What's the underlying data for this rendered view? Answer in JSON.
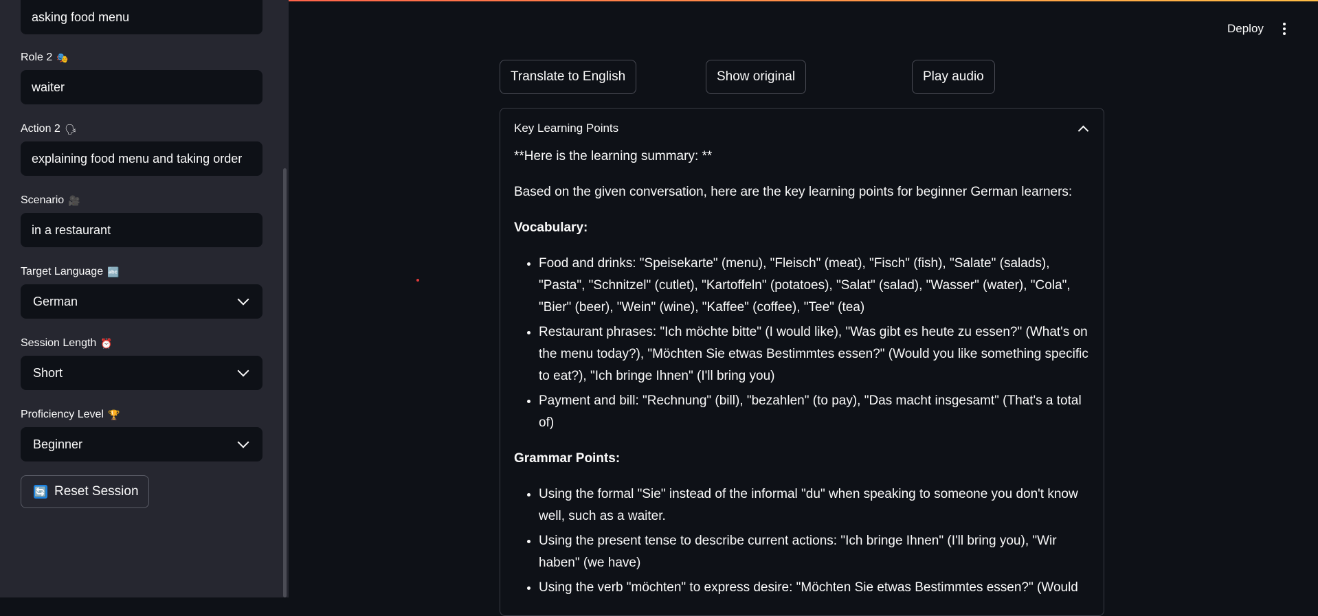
{
  "sidebar": {
    "action1_value": "asking food menu",
    "role2": {
      "label": "Role 2",
      "emoji": "🎭",
      "value": "waiter"
    },
    "action2": {
      "label": "Action 2",
      "emoji": "🗣",
      "value": "explaining food menu and taking order"
    },
    "scenario": {
      "label": "Scenario",
      "emoji": "🎥",
      "value": "in a restaurant"
    },
    "target_language": {
      "label": "Target Language",
      "emoji": "🔤",
      "value": "German"
    },
    "session_length": {
      "label": "Session Length",
      "emoji": "⏰",
      "value": "Short"
    },
    "proficiency": {
      "label": "Proficiency Level",
      "emoji": "🏆",
      "value": "Beginner"
    },
    "reset_label": "Reset Session",
    "reset_icon": "🔄"
  },
  "header": {
    "deploy_label": "Deploy"
  },
  "buttons": {
    "translate": "Translate to English",
    "original": "Show original",
    "audio": "Play audio"
  },
  "expander": {
    "title": "Key Learning Points",
    "summary": "**Here is the learning summary: **",
    "intro": "Based on the given conversation, here are the key learning points for beginner German learners:",
    "vocab_heading": "Vocabulary:",
    "vocab_items": [
      "Food and drinks: \"Speisekarte\" (menu), \"Fleisch\" (meat), \"Fisch\" (fish), \"Salate\" (salads), \"Pasta\", \"Schnitzel\" (cutlet), \"Kartoffeln\" (potatoes), \"Salat\" (salad), \"Wasser\" (water), \"Cola\", \"Bier\" (beer), \"Wein\" (wine), \"Kaffee\" (coffee), \"Tee\" (tea)",
      "Restaurant phrases: \"Ich möchte bitte\" (I would like), \"Was gibt es heute zu essen?\" (What's on the menu today?), \"Möchten Sie etwas Bestimmtes essen?\" (Would you like something specific to eat?), \"Ich bringe Ihnen\" (I'll bring you)",
      "Payment and bill: \"Rechnung\" (bill), \"bezahlen\" (to pay), \"Das macht insgesamt\" (That's a total of)"
    ],
    "grammar_heading": "Grammar Points:",
    "grammar_items": [
      "Using the formal \"Sie\" instead of the informal \"du\" when speaking to someone you don't know well, such as a waiter.",
      "Using the present tense to describe current actions: \"Ich bringe Ihnen\" (I'll bring you), \"Wir haben\" (we have)",
      "Using the verb \"möchten\" to express desire: \"Möchten Sie etwas Bestimmtes essen?\" (Would"
    ]
  }
}
